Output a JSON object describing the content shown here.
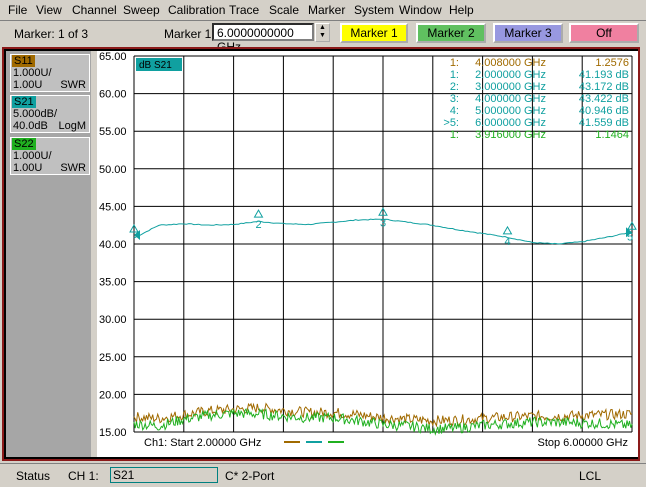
{
  "menu": [
    "File",
    "View",
    "Channel",
    "Sweep",
    "Calibration",
    "Trace",
    "Scale",
    "Marker",
    "System",
    "Window",
    "Help"
  ],
  "toolbar": {
    "marker_count": "Marker: 1 of 3",
    "marker_label": "Marker 1",
    "frequency_value": "6.0000000000 GHz",
    "buttons": [
      {
        "label": "Marker 1",
        "color": "#ffff00"
      },
      {
        "label": "Marker 2",
        "color": "#60c060"
      },
      {
        "label": "Marker 3",
        "color": "#9898e0"
      },
      {
        "label": "Off",
        "color": "#f080a0"
      }
    ]
  },
  "traces": [
    {
      "name": "S11",
      "line1": "1.000U/",
      "line2": "1.00U",
      "format": "SWR",
      "color": "#a06a00"
    },
    {
      "name": "S21",
      "line1": "5.000dB/",
      "line2": "40.0dB",
      "format": "LogM",
      "color": "#10a0a0"
    },
    {
      "name": "S22",
      "line1": "1.000U/",
      "line2": "1.00U",
      "format": "SWR",
      "color": "#20b020"
    }
  ],
  "plot": {
    "active_trace_label": "dB S21",
    "y_ticks": [
      "65.00",
      "60.00",
      "55.00",
      "50.00",
      "45.00",
      "40.00",
      "35.00",
      "30.00",
      "25.00",
      "20.00",
      "15.00"
    ],
    "start_label": "Ch1: Start  2.00000 GHz",
    "stop_label": "Stop  6.00000 GHz",
    "marker_table": [
      {
        "id": "1:",
        "freq": "4.008000 GHz",
        "value": "1.2576",
        "color": "#a06a00"
      },
      {
        "id": "1:",
        "freq": "2.000000 GHz",
        "value": "41.193 dB",
        "color": "#10a0a0"
      },
      {
        "id": "2:",
        "freq": "3.000000 GHz",
        "value": "43.172 dB",
        "color": "#10a0a0"
      },
      {
        "id": "3:",
        "freq": "4.000000 GHz",
        "value": "43.422 dB",
        "color": "#10a0a0"
      },
      {
        "id": "4:",
        "freq": "5.000000 GHz",
        "value": "40.946 dB",
        "color": "#10a0a0"
      },
      {
        "id": ">5:",
        "freq": "6.000000 GHz",
        "value": "41.559 dB",
        "color": "#10a0a0"
      },
      {
        "id": "1:",
        "freq": "3.916000 GHz",
        "value": "1.1464",
        "color": "#20b020"
      }
    ],
    "marker_labels": [
      "2",
      "3",
      "4",
      "5"
    ]
  },
  "chart_data": {
    "type": "line",
    "title": "dB S21",
    "xlabel": "",
    "ylabel": "",
    "xlim": [
      2.0,
      6.0
    ],
    "ylim": [
      15.0,
      65.0
    ],
    "grid": true,
    "series": [
      {
        "name": "S21",
        "color": "#10a0a0",
        "x": [
          2.0,
          2.2,
          2.4,
          2.6,
          2.8,
          3.0,
          3.2,
          3.4,
          3.6,
          3.8,
          4.0,
          4.2,
          4.4,
          4.6,
          4.8,
          5.0,
          5.2,
          5.4,
          5.6,
          5.8,
          6.0
        ],
        "y": [
          40.8,
          42.5,
          42.7,
          42.5,
          42.6,
          43.0,
          42.7,
          42.6,
          42.9,
          43.2,
          43.3,
          42.9,
          42.5,
          41.9,
          41.4,
          40.9,
          40.2,
          40.0,
          40.3,
          40.9,
          41.6
        ]
      },
      {
        "name": "S11",
        "color": "#a06a00",
        "x": [
          2.0,
          2.2,
          2.4,
          2.6,
          2.8,
          3.0,
          3.2,
          3.4,
          3.6,
          3.8,
          4.0,
          4.2,
          4.4,
          4.6,
          4.8,
          5.0,
          5.2,
          5.4,
          5.6,
          5.8,
          6.0
        ],
        "y": [
          17.0,
          16.8,
          17.3,
          17.8,
          18.0,
          18.2,
          17.9,
          17.6,
          17.6,
          17.3,
          16.9,
          16.7,
          16.5,
          16.6,
          16.8,
          17.0,
          17.1,
          17.1,
          17.2,
          17.3,
          17.4
        ]
      },
      {
        "name": "S22",
        "color": "#20b020",
        "x": [
          2.0,
          2.2,
          2.4,
          2.6,
          2.8,
          3.0,
          3.2,
          3.4,
          3.6,
          3.8,
          4.0,
          4.2,
          4.4,
          4.6,
          4.8,
          5.0,
          5.2,
          5.4,
          5.6,
          5.8,
          6.0
        ],
        "y": [
          16.1,
          15.8,
          16.7,
          17.2,
          17.5,
          17.4,
          17.1,
          16.9,
          16.9,
          16.5,
          16.0,
          15.8,
          15.4,
          15.5,
          15.9,
          16.1,
          16.3,
          16.3,
          16.2,
          16.1,
          15.8
        ]
      }
    ],
    "markers": [
      {
        "label": "1",
        "x": 2.0,
        "y": 41.193
      },
      {
        "label": "2",
        "x": 3.0,
        "y": 43.172
      },
      {
        "label": "3",
        "x": 4.0,
        "y": 43.422
      },
      {
        "label": "4",
        "x": 5.0,
        "y": 40.946
      },
      {
        "label": "5",
        "x": 6.0,
        "y": 41.559
      }
    ]
  },
  "status": {
    "label": "Status",
    "channel": "CH 1:",
    "trace": "S21",
    "cal": "C* 2-Port",
    "mode": "LCL"
  }
}
